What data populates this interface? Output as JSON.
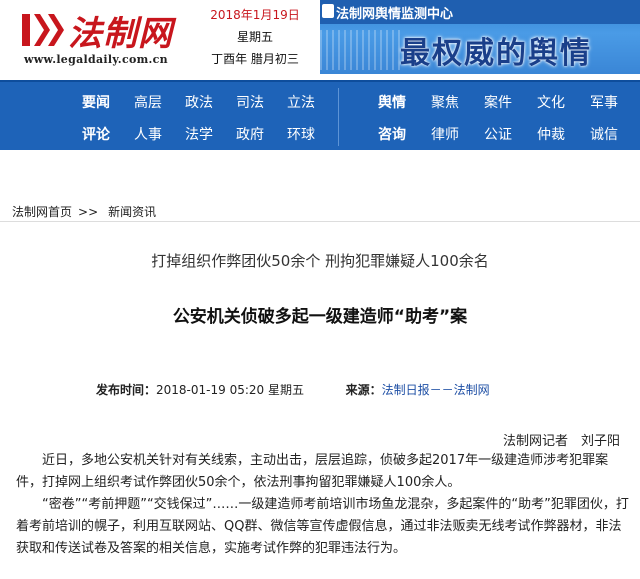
{
  "header": {
    "logo_text": "法制网",
    "logo_url": "www.legaldaily.com.cn",
    "date": "2018年1月19日",
    "weekday": "星期五",
    "lunar": "丁酉年 腊月初三"
  },
  "banner": {
    "top_label": "法制网舆情监测中心",
    "main_text": "最权威的舆情"
  },
  "nav": {
    "row1_left": [
      "要闻",
      "高层",
      "政法",
      "司法",
      "立法"
    ],
    "row1_right": [
      "舆情",
      "聚焦",
      "案件",
      "文化",
      "军事"
    ],
    "row2_left": [
      "评论",
      "人事",
      "法学",
      "政府",
      "环球"
    ],
    "row2_right": [
      "咨询",
      "律师",
      "公证",
      "仲裁",
      "诚信"
    ]
  },
  "breadcrumb": {
    "home": "法制网首页",
    "sep": ">>",
    "current": "新闻资讯"
  },
  "article": {
    "subtitle": "打掉组织作弊团伙50余个 刑拘犯罪嫌疑人100余名",
    "title": "公安机关侦破多起一级建造师“助考”案",
    "publish_label": "发布时间：",
    "publish_time": "2018-01-19 05:20 星期五",
    "source_label": "来源：",
    "source": "法制日报－－法制网",
    "author": "法制网记者　刘子阳",
    "p1": "近日，多地公安机关针对有关线索，主动出击，层层追踪，侦破多起2017年一级建造师涉考犯罪案件，打掉网上组织考试作弊团伙50余个，依法刑事拘留犯罪嫌疑人100余人。",
    "p2": "“密卷”“考前押题”“交钱保过”……一级建造师考前培训市场鱼龙混杂，多起案件的“助考”犯罪团伙，打着考前培训的幌子，利用互联网站、QQ群、微信等宣传虚假信息，通过非法贩卖无线考试作弊器材，非法获取和传送试卷及答案的相关信息，实施考试作弊的犯罪违法行为。"
  },
  "colors": {
    "brand_red": "#c8161d",
    "nav_blue": "#1e63b8",
    "link_blue": "#1e4fa5"
  }
}
